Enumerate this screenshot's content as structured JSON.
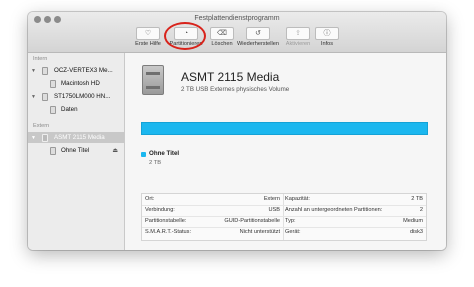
{
  "window": {
    "title": "Festplattendienstprogramm"
  },
  "toolbar": {
    "items": [
      {
        "label": "Erste Hilfe",
        "icon": "stethoscope-icon",
        "glyph": "♡",
        "enabled": true
      },
      {
        "label": "Partitionieren",
        "icon": "partition-icon",
        "glyph": "◔",
        "enabled": true
      },
      {
        "label": "Löschen",
        "icon": "erase-icon",
        "glyph": "⌫",
        "enabled": true
      },
      {
        "label": "Wiederherstellen",
        "icon": "restore-icon",
        "glyph": "↺",
        "enabled": true
      },
      {
        "label": "Aktivieren",
        "icon": "mount-icon",
        "glyph": "⇪",
        "enabled": false
      },
      {
        "label": "Infos",
        "icon": "info-icon",
        "glyph": "ⓘ",
        "enabled": true
      }
    ]
  },
  "sidebar": {
    "internal_header": "Intern",
    "external_header": "Extern",
    "items": [
      {
        "label": "OCZ-VERTEX3 Me..."
      },
      {
        "label": "Macintosh HD"
      },
      {
        "label": "ST1750LM000 HN..."
      },
      {
        "label": "Daten"
      },
      {
        "label": "ASMT 2115 Media"
      },
      {
        "label": "Ohne Titel"
      }
    ]
  },
  "device": {
    "name": "ASMT 2115 Media",
    "subtitle": "2 TB USB Externes physisches Volume"
  },
  "usage": {
    "color": "#1bb7ef",
    "partition_name": "Ohne Titel",
    "partition_size": "2 TB"
  },
  "info_table": {
    "rows": [
      {
        "k1": "Ort:",
        "v1": "Extern",
        "k2": "Kapazität:",
        "v2": "2 TB"
      },
      {
        "k1": "Verbindung:",
        "v1": "USB",
        "k2": "Anzahl an untergeordneten Partitionen:",
        "v2": "2"
      },
      {
        "k1": "Partitionstabelle:",
        "v1": "GUID-Partitionstabelle",
        "k2": "Typ:",
        "v2": "Medium"
      },
      {
        "k1": "S.M.A.R.T.-Status:",
        "v1": "Nicht unterstützt",
        "k2": "Gerät:",
        "v2": "disk3"
      }
    ]
  },
  "colors": {
    "annotation_circle": "#d8231b",
    "accent": "#1bb7ef"
  }
}
